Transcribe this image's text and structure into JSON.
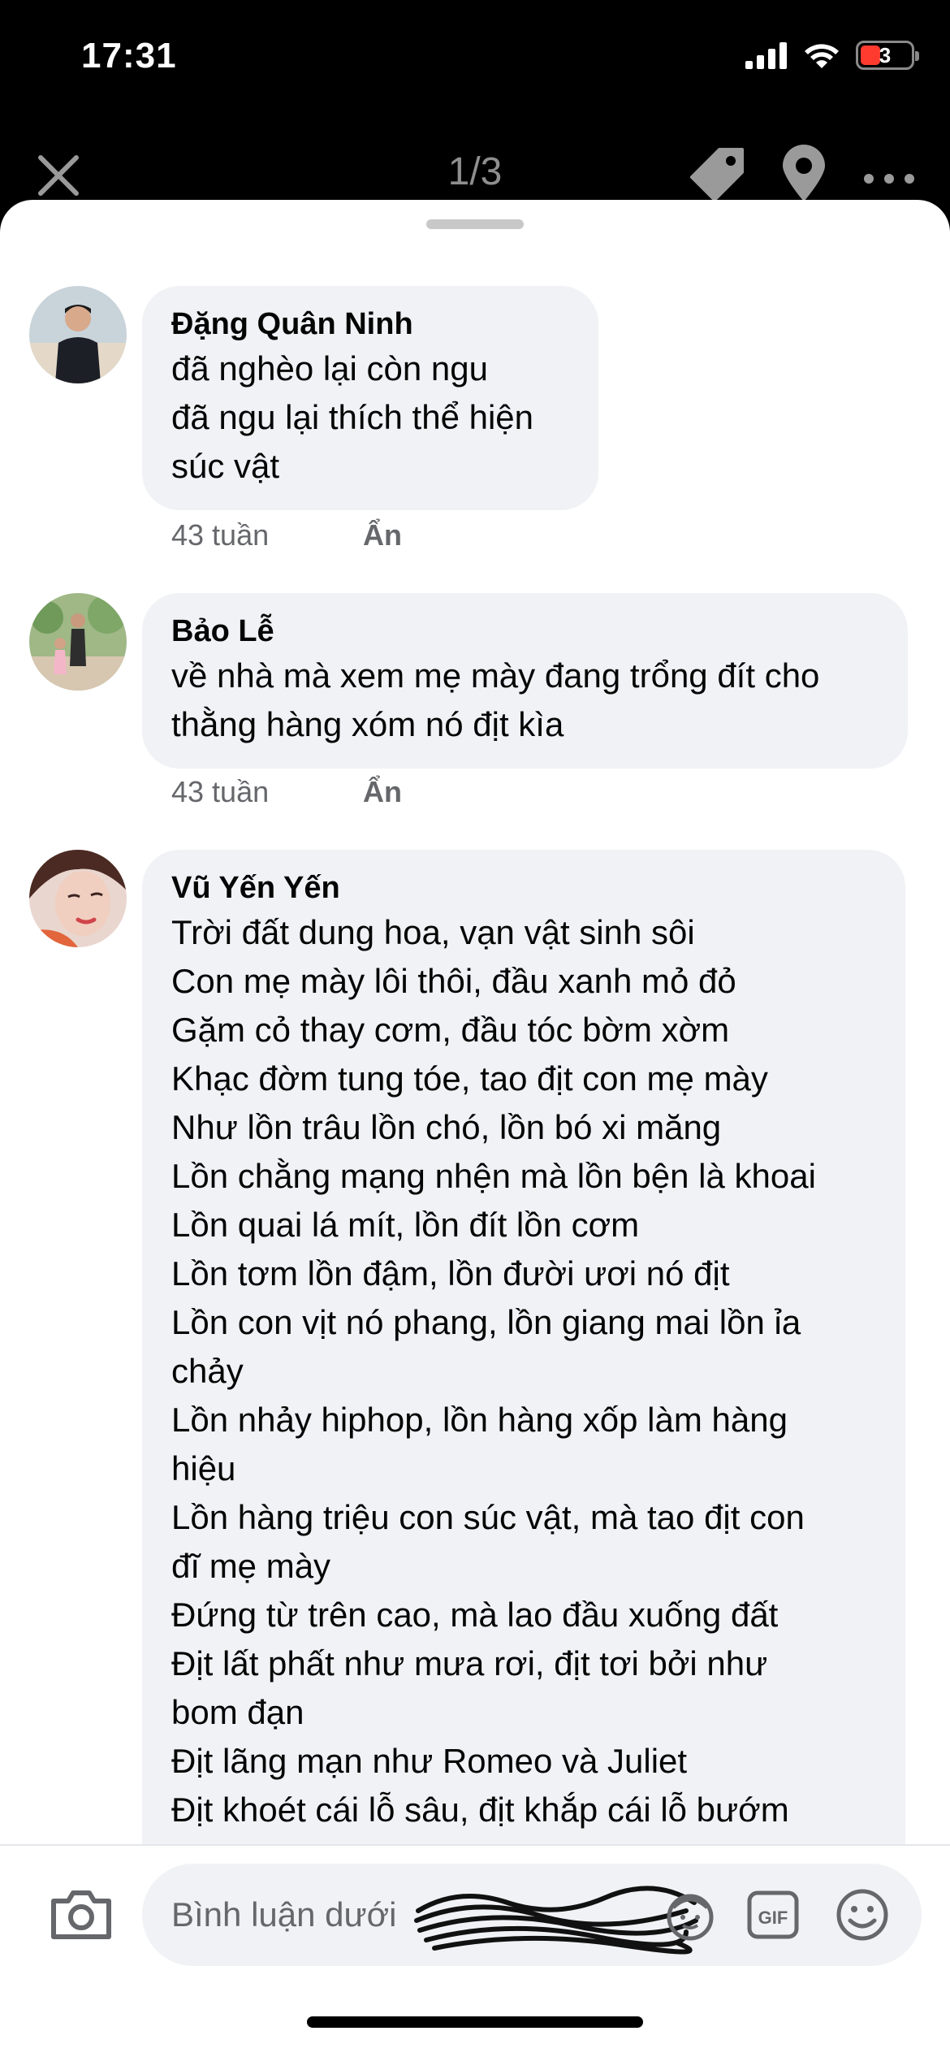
{
  "status_bar": {
    "time": "17:31",
    "battery_level": "3",
    "icons": [
      "cellular-signal-icon",
      "wifi-icon",
      "battery-icon"
    ]
  },
  "viewer": {
    "page_counter": "1/3",
    "icons": [
      "close-icon",
      "tag-icon",
      "location-pin-icon",
      "more-icon"
    ]
  },
  "comments": [
    {
      "author": "Đặng Quân Ninh",
      "text": "đã nghèo lại còn ngu\nđã ngu lại thích thể hiện\nsúc vật",
      "time": "43 tuần",
      "hide_label": "Ẩn"
    },
    {
      "author": "Bảo Lễ",
      "text": "về nhà mà xem mẹ mày đang trổng đít cho\nthằng hàng xóm nó địt kìa",
      "time": "43 tuần",
      "hide_label": "Ẩn"
    },
    {
      "author": "Vũ Yến Yến",
      "text": "Trời đất dung hoa, vạn vật sinh sôi\nCon mẹ mày lôi thôi, đầu xanh mỏ đỏ\nGặm cỏ thay cơm, đầu tóc bờm xờm\nKhạc đờm tung tóe, tao địt con mẹ mày\nNhư lồn trâu lồn chó, lồn bó xi măng\nLồn chằng mạng nhện mà lồn bện là khoai\nLồn quai lá mít, lồn đít lồn cơm\nLồn tơm lồn đậm, lồn đười ươi nó địt\nLồn con vịt nó phang, lồn giang mai lồn ỉa\nchảy\nLồn nhảy hiphop, lồn hàng xốp làm hàng\nhiệu\nLồn hàng triệu con súc vật, mà tao địt con\nđĩ mẹ mày\nĐứng từ trên cao, mà lao đầu xuống đất\nĐịt lất phất như mưa rơi, địt tơi bởi như\nbom đạn\nĐịt lãng mạn như Romeo và Juliet\nĐịt khoét cái lỗ sâu, địt khắp cái lỗ bướm"
    }
  ],
  "composer": {
    "placeholder": "Bình luận dưới",
    "icons": [
      "camera-icon",
      "avatar-sticker-icon",
      "gif-icon",
      "emoji-icon"
    ]
  }
}
